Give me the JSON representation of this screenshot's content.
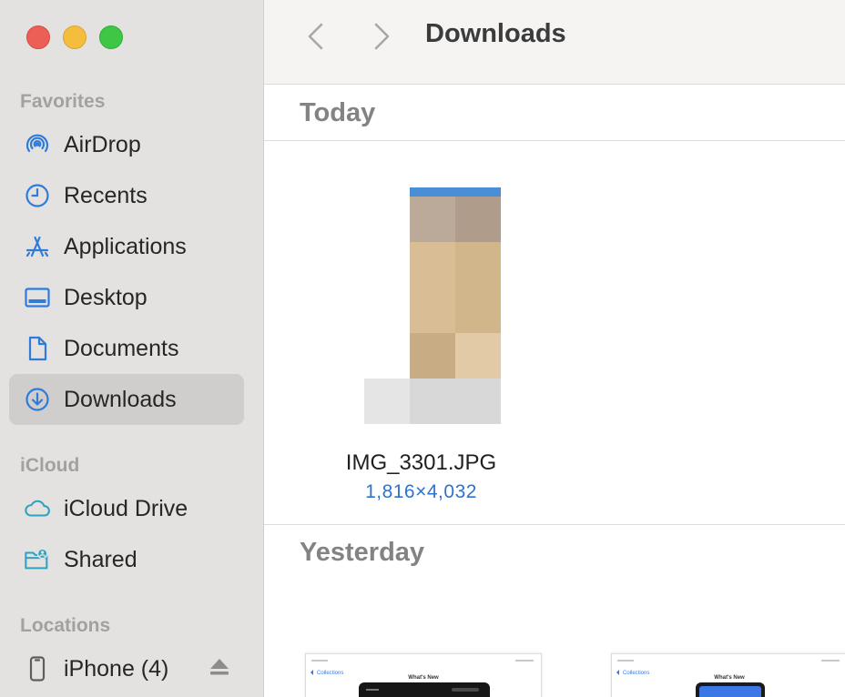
{
  "window": {
    "title": "Downloads"
  },
  "sidebar": {
    "sections": {
      "favorites": "Favorites",
      "icloud": "iCloud",
      "locations": "Locations"
    },
    "favorites": [
      {
        "label": "AirDrop",
        "icon": "airdrop-icon"
      },
      {
        "label": "Recents",
        "icon": "clock-icon"
      },
      {
        "label": "Applications",
        "icon": "applications-icon"
      },
      {
        "label": "Desktop",
        "icon": "desktop-icon"
      },
      {
        "label": "Documents",
        "icon": "document-icon"
      },
      {
        "label": "Downloads",
        "icon": "download-icon",
        "selected": true
      }
    ],
    "icloud": [
      {
        "label": "iCloud Drive",
        "icon": "cloud-icon"
      },
      {
        "label": "Shared",
        "icon": "shared-folder-icon"
      }
    ],
    "locations": [
      {
        "label": "iPhone (4)",
        "icon": "iphone-icon"
      }
    ]
  },
  "groups": {
    "today": "Today",
    "yesterday": "Yesterday"
  },
  "files": [
    {
      "name": "IMG_3301.JPG",
      "dimensions": "1,816×4,032"
    }
  ],
  "doc_thumbs": {
    "back_link": "Collections",
    "title": "What's New"
  },
  "colors": {
    "accent": "#2c73d2",
    "sidebar_bg": "#e4e2e1",
    "selected_bg": "#d0cecd",
    "close": "#ec5f56",
    "minimize": "#f4bd3c",
    "zoom": "#3ec745"
  }
}
